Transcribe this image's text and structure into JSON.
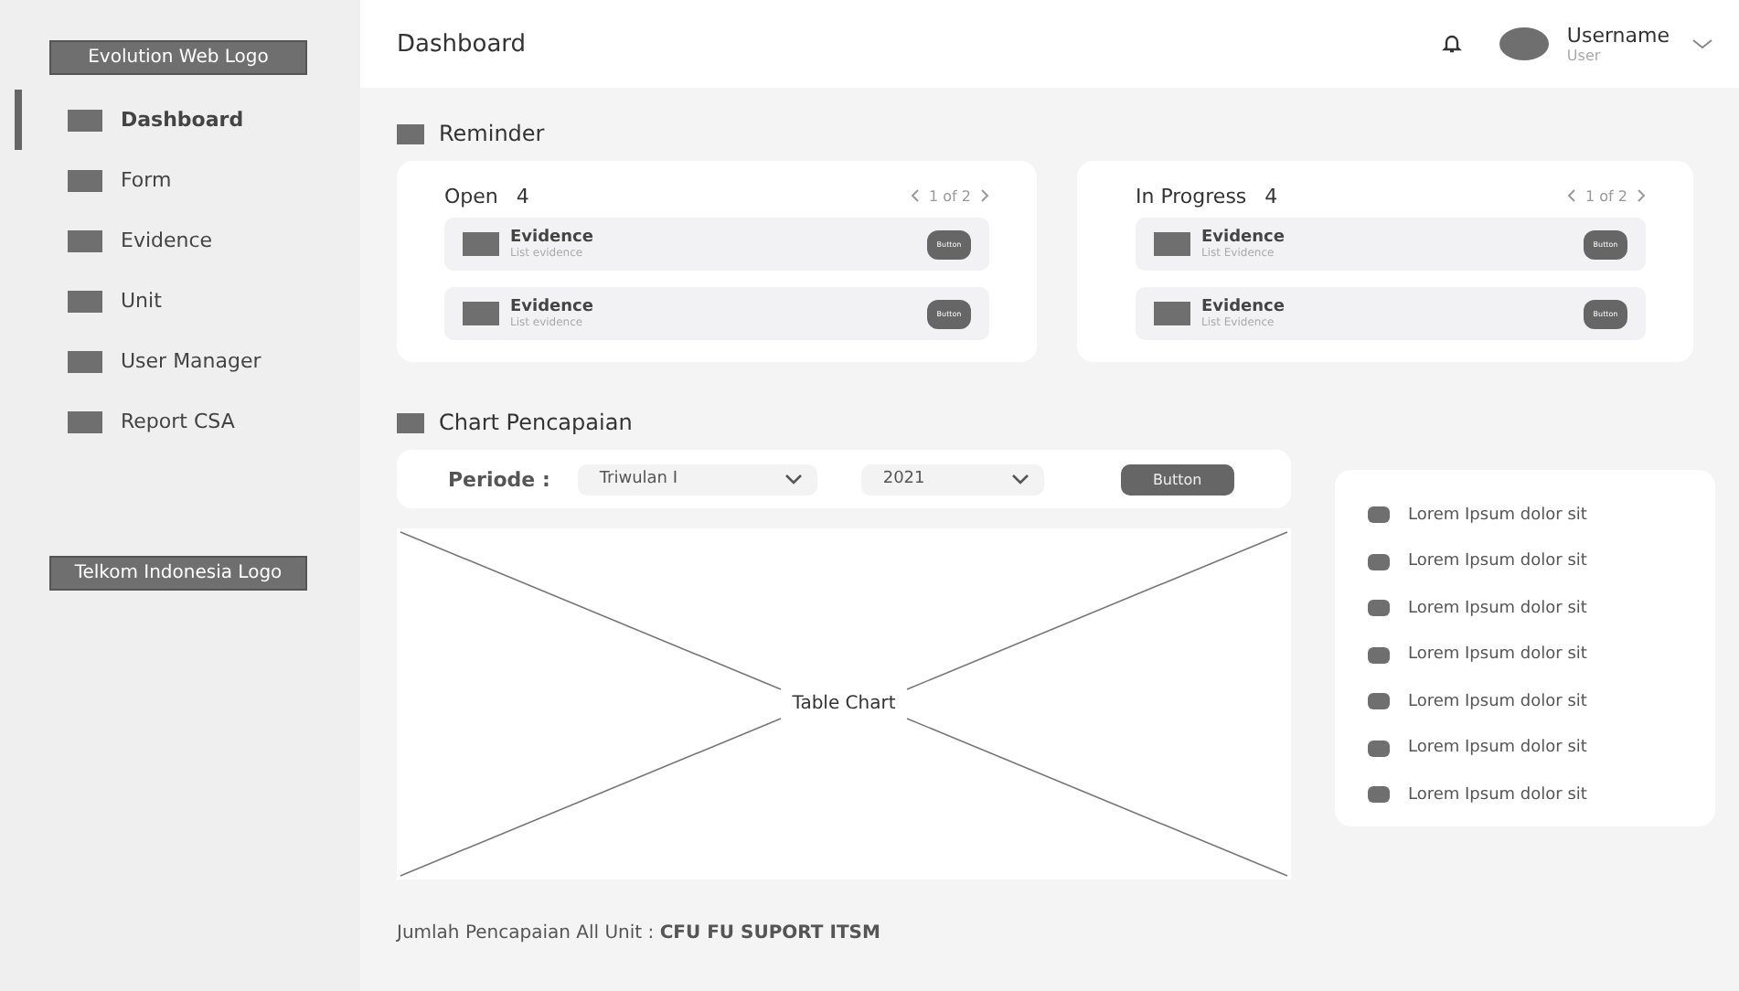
{
  "sidebar": {
    "logo": "Evolution Web Logo",
    "items": [
      {
        "label": "Dashboard",
        "selected": true
      },
      {
        "label": "Form",
        "selected": false
      },
      {
        "label": "Evidence",
        "selected": false
      },
      {
        "label": "Unit",
        "selected": false
      },
      {
        "label": "User Manager",
        "selected": false
      },
      {
        "label": "Report CSA",
        "selected": false
      }
    ],
    "footer_logo": "Telkom Indonesia Logo"
  },
  "header": {
    "title": "Dashboard",
    "user": {
      "name": "Username",
      "role": "User"
    }
  },
  "reminder": {
    "title": "Reminder",
    "cards": [
      {
        "title": "Open",
        "count": "4",
        "pager": "1 of 2",
        "items": [
          {
            "title": "Evidence",
            "subtitle": "List evidence",
            "button": "Button"
          },
          {
            "title": "Evidence",
            "subtitle": "List evidence",
            "button": "Button"
          }
        ]
      },
      {
        "title": "In Progress",
        "count": "4",
        "pager": "1 of 2",
        "items": [
          {
            "title": "Evidence",
            "subtitle": "List Evidence",
            "button": "Button"
          },
          {
            "title": "Evidence",
            "subtitle": "List Evidence",
            "button": "Button"
          }
        ]
      }
    ]
  },
  "chart_section": {
    "title": "Chart Pencapaian",
    "filter": {
      "label": "Periode :",
      "period": "Triwulan I",
      "year": "2021",
      "button": "Button"
    },
    "placeholder": "Table Chart",
    "legend": [
      "Lorem Ipsum dolor sit",
      "Lorem Ipsum dolor sit",
      "Lorem Ipsum dolor sit",
      "Lorem Ipsum dolor sit",
      "Lorem Ipsum dolor sit",
      "Lorem Ipsum dolor sit",
      "Lorem Ipsum dolor sit"
    ],
    "summary": "Jumlah Pencapaian All Unit : **CFU FU SUPORT ITSM**"
  }
}
